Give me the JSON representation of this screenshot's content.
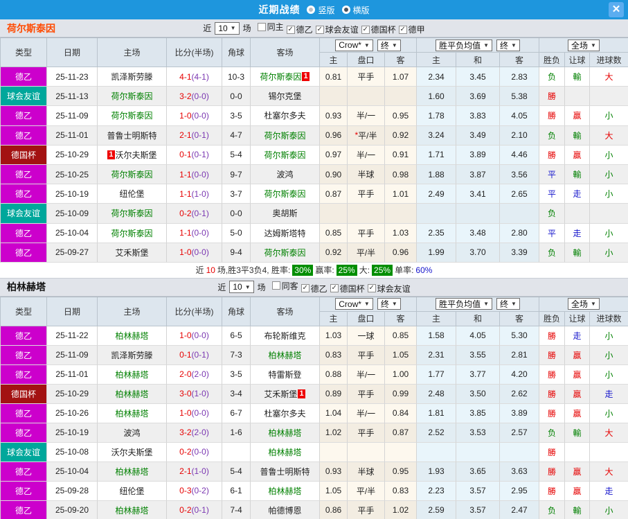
{
  "colors": {
    "topbar": "#1e96dd",
    "team_green": "#008000",
    "team_black": "#222222",
    "section1_title": "#ff4a00",
    "section2_title": "#111111",
    "score_ft": "#e60000",
    "score_ht": "#7a36b1",
    "type": {
      "德乙": "#cc00cc",
      "球会友谊": "#00a79b",
      "德国杯": "#a31212"
    },
    "result": {
      "勝": "#e60000",
      "贏": "#e60000",
      "大": "#e60000",
      "负": "#008000",
      "輸": "#008000",
      "小": "#008000",
      "平": "#1414cc",
      "走": "#1414cc"
    }
  },
  "icons": {
    "check": "✓",
    "arrow_down": "▼",
    "close": "✕"
  },
  "titlebar": {
    "title": "近期战绩",
    "vertical_label": "竖版",
    "horizontal_label": "横版",
    "selected": "横版"
  },
  "table_header": {
    "type": "类型",
    "date": "日期",
    "home": "主场",
    "score": "比分(半场)",
    "corner": "角球",
    "away": "客场",
    "crow_select": "Crow*",
    "final_select": "终",
    "avg_select": "胜平负均值",
    "final_select2": "终",
    "fullmatch_select": "全场",
    "h_home": "主",
    "h_line": "盘口",
    "h_away": "客",
    "a_home": "主",
    "a_draw": "和",
    "a_away": "客",
    "r_wdl": "胜负",
    "r_handicap": "让球",
    "r_goals": "进球数"
  },
  "sections": [
    {
      "team": "荷尔斯泰因",
      "filter": {
        "near": "近",
        "count": "10",
        "unit": "场",
        "checks": [
          {
            "label": "同主",
            "checked": false
          },
          {
            "label": "德乙",
            "checked": true
          },
          {
            "label": "球会友谊",
            "checked": true
          },
          {
            "label": "德国杯",
            "checked": true
          },
          {
            "label": "德甲",
            "checked": true
          }
        ]
      },
      "rows": [
        {
          "type": "德乙",
          "date": "25-11-23",
          "home": "凯泽斯劳滕",
          "home_green": false,
          "home_badge": "",
          "home_badge_pos": "after",
          "ft": "4-1",
          "ht": "(4-1)",
          "corner": "10-3",
          "away": "荷尔斯泰因",
          "away_green": true,
          "away_badge": "1",
          "away_badge_pos": "after",
          "odds": [
            "0.81",
            "平手",
            "1.07"
          ],
          "line_star": false,
          "avg": [
            "2.34",
            "3.45",
            "2.83"
          ],
          "results": [
            "负",
            "輸",
            "大"
          ]
        },
        {
          "type": "球会友谊",
          "date": "25-11-13",
          "home": "荷尔斯泰因",
          "home_green": true,
          "home_badge": "",
          "home_badge_pos": "after",
          "ft": "3-2",
          "ht": "(0-0)",
          "corner": "0-0",
          "away": "锡尔克堡",
          "away_green": false,
          "away_badge": "",
          "away_badge_pos": "after",
          "odds": [
            "",
            "",
            ""
          ],
          "line_star": false,
          "avg": [
            "1.60",
            "3.69",
            "5.38"
          ],
          "results": [
            "勝",
            "",
            ""
          ]
        },
        {
          "type": "德乙",
          "date": "25-11-09",
          "home": "荷尔斯泰因",
          "home_green": true,
          "home_badge": "",
          "home_badge_pos": "after",
          "ft": "1-0",
          "ht": "(0-0)",
          "corner": "3-5",
          "away": "杜塞尔多夫",
          "away_green": false,
          "away_badge": "",
          "away_badge_pos": "after",
          "odds": [
            "0.93",
            "半/一",
            "0.95"
          ],
          "line_star": false,
          "avg": [
            "1.78",
            "3.83",
            "4.05"
          ],
          "results": [
            "勝",
            "贏",
            "小"
          ]
        },
        {
          "type": "德乙",
          "date": "25-11-01",
          "home": "普鲁士明斯特",
          "home_green": false,
          "home_badge": "",
          "home_badge_pos": "after",
          "ft": "2-1",
          "ht": "(0-1)",
          "corner": "4-7",
          "away": "荷尔斯泰因",
          "away_green": true,
          "away_badge": "",
          "away_badge_pos": "after",
          "odds": [
            "0.96",
            "平/半",
            "0.92"
          ],
          "line_star": true,
          "avg": [
            "3.24",
            "3.49",
            "2.10"
          ],
          "results": [
            "负",
            "輸",
            "大"
          ]
        },
        {
          "type": "德国杯",
          "date": "25-10-29",
          "home": "沃尔夫斯堡",
          "home_green": false,
          "home_badge": "1",
          "home_badge_pos": "before",
          "ft": "0-1",
          "ht": "(0-1)",
          "corner": "5-4",
          "away": "荷尔斯泰因",
          "away_green": true,
          "away_badge": "",
          "away_badge_pos": "after",
          "odds": [
            "0.97",
            "半/一",
            "0.91"
          ],
          "line_star": false,
          "avg": [
            "1.71",
            "3.89",
            "4.46"
          ],
          "results": [
            "勝",
            "贏",
            "小"
          ]
        },
        {
          "type": "德乙",
          "date": "25-10-25",
          "home": "荷尔斯泰因",
          "home_green": true,
          "home_badge": "",
          "home_badge_pos": "after",
          "ft": "1-1",
          "ht": "(0-0)",
          "corner": "9-7",
          "away": "波鸿",
          "away_green": false,
          "away_badge": "",
          "away_badge_pos": "after",
          "odds": [
            "0.90",
            "半球",
            "0.98"
          ],
          "line_star": false,
          "avg": [
            "1.88",
            "3.87",
            "3.56"
          ],
          "results": [
            "平",
            "輸",
            "小"
          ]
        },
        {
          "type": "德乙",
          "date": "25-10-19",
          "home": "纽伦堡",
          "home_green": false,
          "home_badge": "",
          "home_badge_pos": "after",
          "ft": "1-1",
          "ht": "(1-0)",
          "corner": "3-7",
          "away": "荷尔斯泰因",
          "away_green": true,
          "away_badge": "",
          "away_badge_pos": "after",
          "odds": [
            "0.87",
            "平手",
            "1.01"
          ],
          "line_star": false,
          "avg": [
            "2.49",
            "3.41",
            "2.65"
          ],
          "results": [
            "平",
            "走",
            "小"
          ]
        },
        {
          "type": "球会友谊",
          "date": "25-10-09",
          "home": "荷尔斯泰因",
          "home_green": true,
          "home_badge": "",
          "home_badge_pos": "after",
          "ft": "0-2",
          "ht": "(0-1)",
          "corner": "0-0",
          "away": "奥胡斯",
          "away_green": false,
          "away_badge": "",
          "away_badge_pos": "after",
          "odds": [
            "",
            "",
            ""
          ],
          "line_star": false,
          "avg": [
            "",
            "",
            ""
          ],
          "results": [
            "负",
            "",
            ""
          ]
        },
        {
          "type": "德乙",
          "date": "25-10-04",
          "home": "荷尔斯泰因",
          "home_green": true,
          "home_badge": "",
          "home_badge_pos": "after",
          "ft": "1-1",
          "ht": "(0-0)",
          "corner": "5-0",
          "away": "达姆斯塔特",
          "away_green": false,
          "away_badge": "",
          "away_badge_pos": "after",
          "odds": [
            "0.85",
            "平手",
            "1.03"
          ],
          "line_star": false,
          "avg": [
            "2.35",
            "3.48",
            "2.80"
          ],
          "results": [
            "平",
            "走",
            "小"
          ]
        },
        {
          "type": "德乙",
          "date": "25-09-27",
          "home": "艾禾斯堡",
          "home_green": false,
          "home_badge": "",
          "home_badge_pos": "after",
          "ft": "1-0",
          "ht": "(0-0)",
          "corner": "9-4",
          "away": "荷尔斯泰因",
          "away_green": true,
          "away_badge": "",
          "away_badge_pos": "after",
          "odds": [
            "0.92",
            "平/半",
            "0.96"
          ],
          "line_star": false,
          "avg": [
            "1.99",
            "3.70",
            "3.39"
          ],
          "results": [
            "负",
            "輸",
            "小"
          ]
        }
      ],
      "summary": {
        "prefix": "近",
        "count": "10",
        "text1": "场,胜3平3负4, 胜率:",
        "win_rate": "30%",
        "text2": "赢率:",
        "handicap_rate": "25%",
        "text3": "大:",
        "big_rate": "25%",
        "text4": "单率:",
        "single_rate": "60%"
      }
    },
    {
      "team": "柏林赫塔",
      "filter": {
        "near": "近",
        "count": "10",
        "unit": "场",
        "checks": [
          {
            "label": "同客",
            "checked": false
          },
          {
            "label": "德乙",
            "checked": true
          },
          {
            "label": "德国杯",
            "checked": true
          },
          {
            "label": "球会友谊",
            "checked": true
          }
        ]
      },
      "rows": [
        {
          "type": "德乙",
          "date": "25-11-22",
          "home": "柏林赫塔",
          "home_green": true,
          "home_badge": "",
          "home_badge_pos": "after",
          "ft": "1-0",
          "ht": "(0-0)",
          "corner": "6-5",
          "away": "布轮斯维克",
          "away_green": false,
          "away_badge": "",
          "away_badge_pos": "after",
          "odds": [
            "1.03",
            "一球",
            "0.85"
          ],
          "line_star": false,
          "avg": [
            "1.58",
            "4.05",
            "5.30"
          ],
          "results": [
            "勝",
            "走",
            "小"
          ]
        },
        {
          "type": "德乙",
          "date": "25-11-09",
          "home": "凯泽斯劳滕",
          "home_green": false,
          "home_badge": "",
          "home_badge_pos": "after",
          "ft": "0-1",
          "ht": "(0-1)",
          "corner": "7-3",
          "away": "柏林赫塔",
          "away_green": true,
          "away_badge": "",
          "away_badge_pos": "after",
          "odds": [
            "0.83",
            "平手",
            "1.05"
          ],
          "line_star": false,
          "avg": [
            "2.31",
            "3.55",
            "2.81"
          ],
          "results": [
            "勝",
            "贏",
            "小"
          ]
        },
        {
          "type": "德乙",
          "date": "25-11-01",
          "home": "柏林赫塔",
          "home_green": true,
          "home_badge": "",
          "home_badge_pos": "after",
          "ft": "2-0",
          "ht": "(2-0)",
          "corner": "3-5",
          "away": "特雷斯登",
          "away_green": false,
          "away_badge": "",
          "away_badge_pos": "after",
          "odds": [
            "0.88",
            "半/一",
            "1.00"
          ],
          "line_star": false,
          "avg": [
            "1.77",
            "3.77",
            "4.20"
          ],
          "results": [
            "勝",
            "贏",
            "小"
          ]
        },
        {
          "type": "德国杯",
          "date": "25-10-29",
          "home": "柏林赫塔",
          "home_green": true,
          "home_badge": "",
          "home_badge_pos": "after",
          "ft": "3-0",
          "ht": "(1-0)",
          "corner": "3-4",
          "away": "艾禾斯堡",
          "away_green": false,
          "away_badge": "1",
          "away_badge_pos": "after",
          "odds": [
            "0.89",
            "平手",
            "0.99"
          ],
          "line_star": false,
          "avg": [
            "2.48",
            "3.50",
            "2.62"
          ],
          "results": [
            "勝",
            "贏",
            "走"
          ]
        },
        {
          "type": "德乙",
          "date": "25-10-26",
          "home": "柏林赫塔",
          "home_green": true,
          "home_badge": "",
          "home_badge_pos": "after",
          "ft": "1-0",
          "ht": "(0-0)",
          "corner": "6-7",
          "away": "杜塞尔多夫",
          "away_green": false,
          "away_badge": "",
          "away_badge_pos": "after",
          "odds": [
            "1.04",
            "半/一",
            "0.84"
          ],
          "line_star": false,
          "avg": [
            "1.81",
            "3.85",
            "3.89"
          ],
          "results": [
            "勝",
            "贏",
            "小"
          ]
        },
        {
          "type": "德乙",
          "date": "25-10-19",
          "home": "波鸿",
          "home_green": false,
          "home_badge": "",
          "home_badge_pos": "after",
          "ft": "3-2",
          "ht": "(2-0)",
          "corner": "1-6",
          "away": "柏林赫塔",
          "away_green": true,
          "away_badge": "",
          "away_badge_pos": "after",
          "odds": [
            "1.02",
            "平手",
            "0.87"
          ],
          "line_star": false,
          "avg": [
            "2.52",
            "3.53",
            "2.57"
          ],
          "results": [
            "负",
            "輸",
            "大"
          ]
        },
        {
          "type": "球会友谊",
          "date": "25-10-08",
          "home": "沃尔夫斯堡",
          "home_green": false,
          "home_badge": "",
          "home_badge_pos": "after",
          "ft": "0-2",
          "ht": "(0-0)",
          "corner": "",
          "away": "柏林赫塔",
          "away_green": true,
          "away_badge": "",
          "away_badge_pos": "after",
          "odds": [
            "",
            "",
            ""
          ],
          "line_star": false,
          "avg": [
            "",
            "",
            ""
          ],
          "results": [
            "勝",
            "",
            ""
          ]
        },
        {
          "type": "德乙",
          "date": "25-10-04",
          "home": "柏林赫塔",
          "home_green": true,
          "home_badge": "",
          "home_badge_pos": "after",
          "ft": "2-1",
          "ht": "(1-0)",
          "corner": "5-4",
          "away": "普鲁士明斯特",
          "away_green": false,
          "away_badge": "",
          "away_badge_pos": "after",
          "odds": [
            "0.93",
            "半球",
            "0.95"
          ],
          "line_star": false,
          "avg": [
            "1.93",
            "3.65",
            "3.63"
          ],
          "results": [
            "勝",
            "贏",
            "大"
          ]
        },
        {
          "type": "德乙",
          "date": "25-09-28",
          "home": "纽伦堡",
          "home_green": false,
          "home_badge": "",
          "home_badge_pos": "after",
          "ft": "0-3",
          "ht": "(0-2)",
          "corner": "6-1",
          "away": "柏林赫塔",
          "away_green": true,
          "away_badge": "",
          "away_badge_pos": "after",
          "odds": [
            "1.05",
            "平/半",
            "0.83"
          ],
          "line_star": false,
          "avg": [
            "2.23",
            "3.57",
            "2.95"
          ],
          "results": [
            "勝",
            "贏",
            "走"
          ]
        },
        {
          "type": "德乙",
          "date": "25-09-20",
          "home": "柏林赫塔",
          "home_green": true,
          "home_badge": "",
          "home_badge_pos": "after",
          "ft": "0-2",
          "ht": "(0-1)",
          "corner": "7-4",
          "away": "帕德博恩",
          "away_green": false,
          "away_badge": "",
          "away_badge_pos": "after",
          "odds": [
            "0.86",
            "平手",
            "1.02"
          ],
          "line_star": false,
          "avg": [
            "2.59",
            "3.57",
            "2.47"
          ],
          "results": [
            "负",
            "輸",
            "小"
          ]
        }
      ]
    }
  ]
}
